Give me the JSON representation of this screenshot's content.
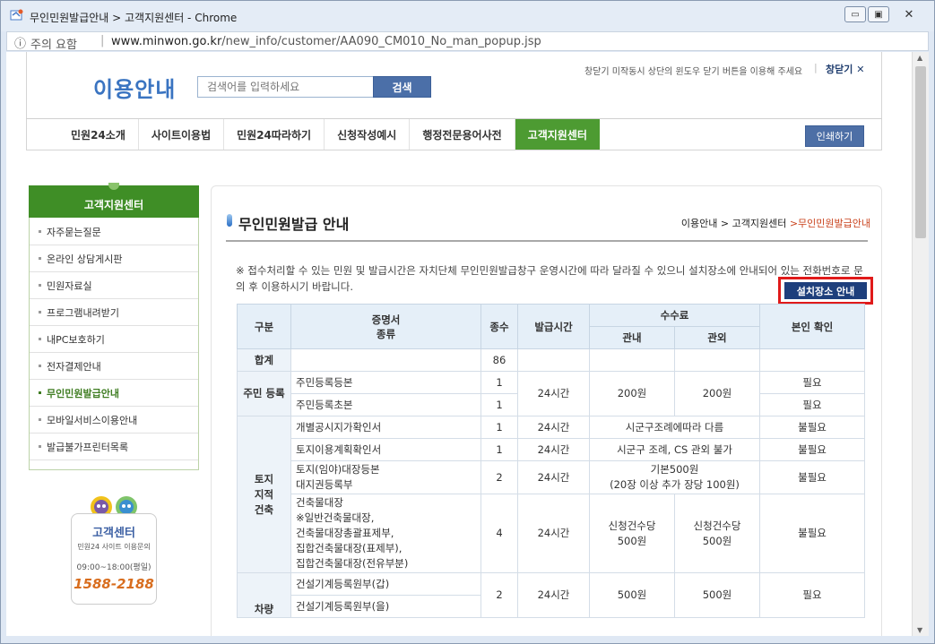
{
  "window": {
    "title": "무인민원발급안내 > 고객지원센터 - Chrome",
    "address_warning": "주의 요함",
    "url_host": "www.minwon.go.kr",
    "url_path": "/new_info/customer/AA090_CM010_No_man_popup.jsp",
    "icons": [
      "browser-app-icon",
      "info-icon",
      "minimize-icon",
      "maximize-icon",
      "close-icon"
    ]
  },
  "header": {
    "logo": "이용안내",
    "search_placeholder": "검색어를 입력하세요",
    "search_button": "검색",
    "close_note": "창닫기 미작동시 상단의 윈도우 닫기 버튼을 이용해 주세요",
    "close_link": "창닫기 ✕",
    "print_button": "인쇄하기",
    "tabs": [
      {
        "label": "민원24소개"
      },
      {
        "label": "사이트이용법"
      },
      {
        "label": "민원24따라하기"
      },
      {
        "label": "신청작성예시"
      },
      {
        "label": "행정전문용어사전"
      },
      {
        "label": "고객지원센터",
        "active": true
      }
    ]
  },
  "sidebar": {
    "title": "고객지원센터",
    "items": [
      {
        "label": "자주묻는질문"
      },
      {
        "label": "온라인 상담게시판"
      },
      {
        "label": "민원자료실"
      },
      {
        "label": "프로그램내려받기"
      },
      {
        "label": "내PC보호하기"
      },
      {
        "label": "전자결제안내"
      },
      {
        "label": "무인민원발급안내",
        "active": true
      },
      {
        "label": "모바일서비스이용안내"
      },
      {
        "label": "발급불가프린터목록"
      }
    ]
  },
  "promo": {
    "title": "고객센터",
    "subtitle": "민원24 사이트 이용문의",
    "hours": "09:00~18:00(평일)",
    "phone": "1588-2188"
  },
  "content": {
    "title": "무인민원발급 안내",
    "breadcrumb": {
      "a": "이용안내 > ",
      "b": "고객지원센터 ",
      "c": ">무인민원발급안내"
    },
    "notice": "※ 접수처리할 수 있는 민원 및 발급시간은 자치단체 무인민원발급창구 운영시간에 따라 달라질 수 있으니 설치장소에 안내되어 있는 전화번호로 문의 후 이용하시기 바랍니다.",
    "location_button": "설치장소 안내"
  },
  "table": {
    "headers": {
      "category": "구분",
      "doc_a": "증명서",
      "doc_b": "종류",
      "count": "종수",
      "hours": "발급시간",
      "fee": "수수료",
      "fee_in": "관내",
      "fee_out": "관외",
      "id_check": "본인 확인"
    },
    "total": {
      "label": "합계",
      "count": "86"
    },
    "resident": {
      "label": "주민 등록",
      "hours": "24시간",
      "fee_in": "200원",
      "fee_out": "200원",
      "rows": [
        {
          "doc": "주민등록등본",
          "count": "1",
          "id": "필요"
        },
        {
          "doc": "주민등록초본",
          "count": "1",
          "id": "필요"
        }
      ]
    },
    "land": {
      "label_1": "토지",
      "label_2": "지적",
      "label_3": "건축",
      "r1": {
        "doc": "개별공시지가확인서",
        "count": "1",
        "hours": "24시간",
        "fee": "시군구조례에따라 다름",
        "id": "불필요"
      },
      "r2": {
        "doc": "토지이용계획확인서",
        "count": "1",
        "hours": "24시간",
        "fee": "시군구 조례, CS 관외 불가",
        "id": "불필요"
      },
      "r3": {
        "doc_1": "토지(임야)대장등본",
        "doc_2": "대지권등록부",
        "count": "2",
        "hours": "24시간",
        "fee_1": "기본500원",
        "fee_2": "(20장 이상 추가 장당 100원)",
        "id": "불필요"
      },
      "r4": {
        "doc_1": "건축물대장",
        "doc_2": "※일반건축물대장,",
        "doc_3": "건축물대장총괄표제부,",
        "doc_4": "집합건축물대장(표제부),",
        "doc_5": "집합건축물대장(전유부분)",
        "count": "4",
        "hours": "24시간",
        "fee_in_1": "신청건수당",
        "fee_in_2": "500원",
        "fee_out_1": "신청건수당",
        "fee_out_2": "500원",
        "id": "불필요"
      }
    },
    "vehicle": {
      "label": "차량",
      "hours": "24시간",
      "count": "2",
      "fee_in": "500원",
      "fee_out": "500원",
      "id": "필요",
      "rows": [
        {
          "doc": "건설기계등록원부(갑)"
        },
        {
          "doc": "건설기계등록원부(을)"
        }
      ]
    }
  }
}
